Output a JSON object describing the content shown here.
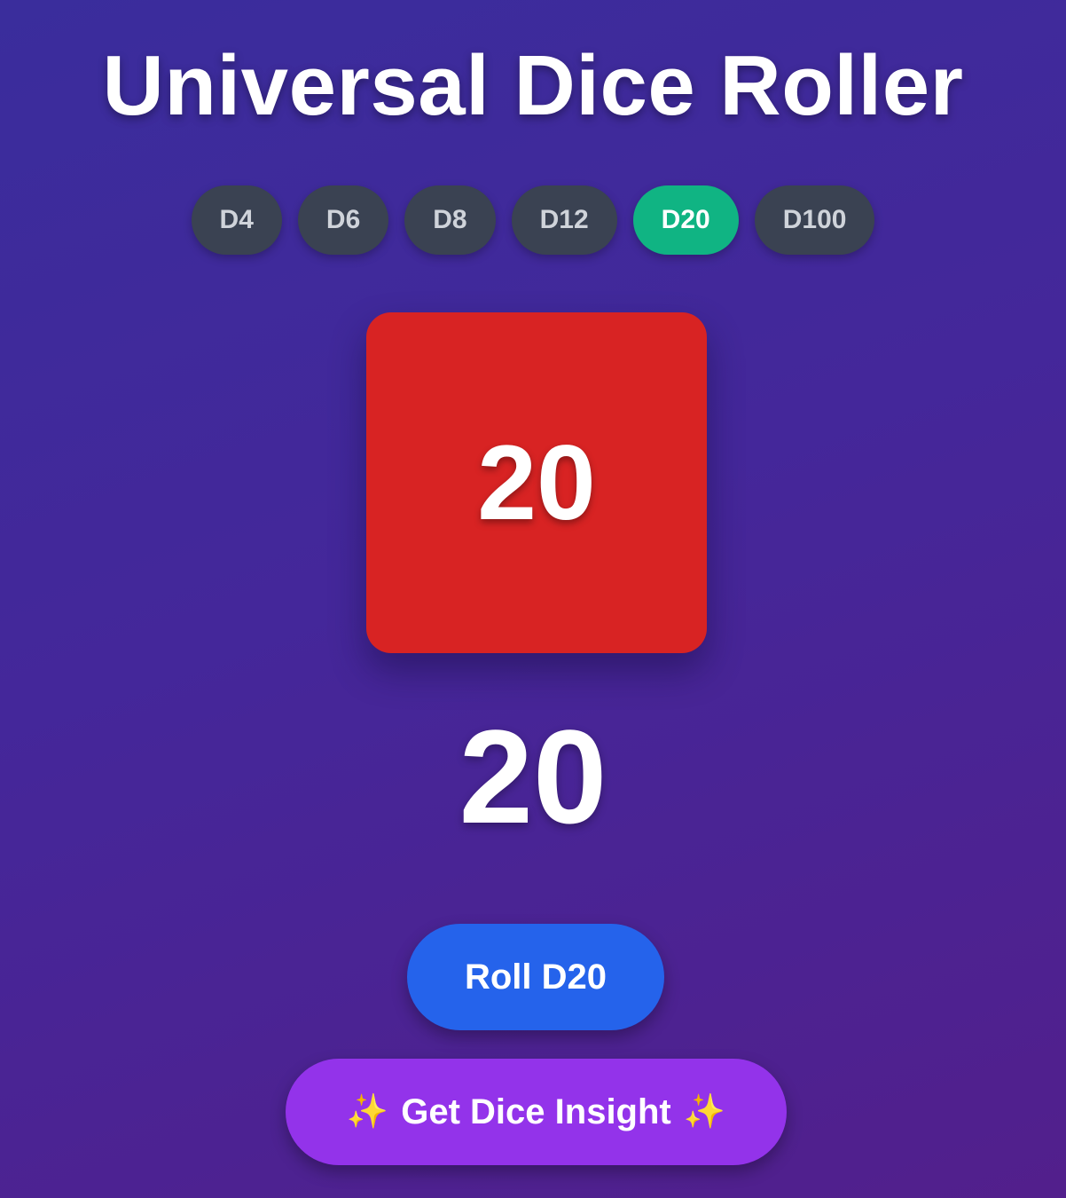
{
  "app": {
    "title": "Universal Dice Roller"
  },
  "dice_types": [
    {
      "label": "D4",
      "active": false
    },
    {
      "label": "D6",
      "active": false
    },
    {
      "label": "D8",
      "active": false
    },
    {
      "label": "D12",
      "active": false
    },
    {
      "label": "D20",
      "active": true
    },
    {
      "label": "D100",
      "active": false
    }
  ],
  "die": {
    "face_value": "20",
    "color": "#d82323"
  },
  "result": {
    "value": "20"
  },
  "actions": {
    "roll_label": "Roll D20",
    "insight_label": "Get Dice Insight",
    "insight_icon": "sparkles-icon"
  },
  "colors": {
    "active_tab": "#10b483",
    "inactive_tab": "#3a4252",
    "roll_button": "#2563eb",
    "insight_button": "#9333ea"
  }
}
